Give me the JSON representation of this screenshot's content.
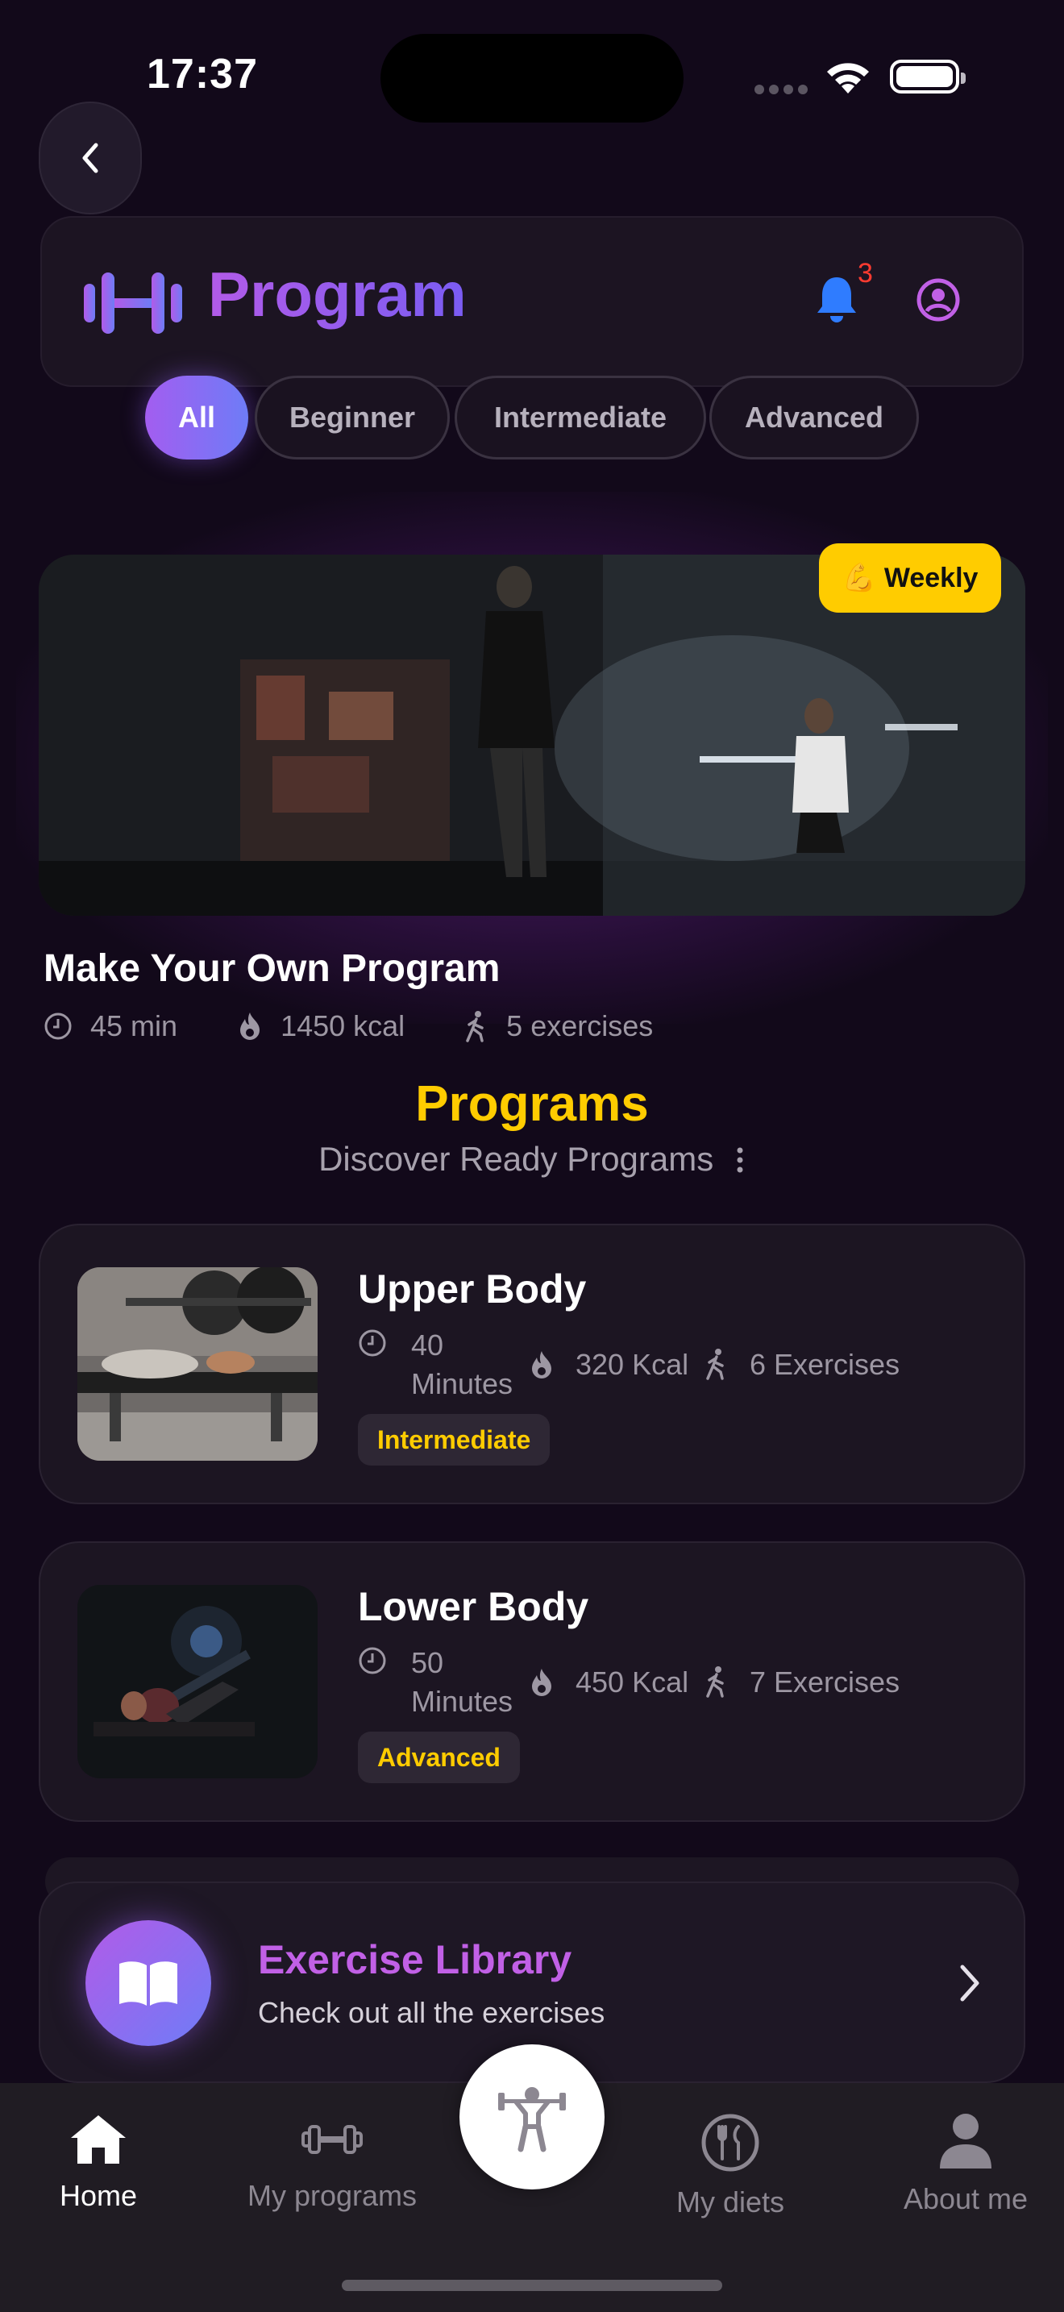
{
  "status_bar": {
    "time": "17:37"
  },
  "header": {
    "title": "Program",
    "notification_count": "3"
  },
  "filters": [
    "All",
    "Beginner",
    "Intermediate",
    "Advanced"
  ],
  "featured": {
    "badge_emoji": "💪",
    "badge_label": "Weekly",
    "title": "Make Your Own Program",
    "duration": "45 min",
    "calories": "1450 kcal",
    "exercises": "5 exercises"
  },
  "programs_section": {
    "title": "Programs",
    "subtitle": "Discover Ready Programs"
  },
  "programs": [
    {
      "title": "Upper Body",
      "duration_value": "40",
      "duration_unit": "Minutes",
      "calories": "320 Kcal",
      "exercises": "6 Exercises",
      "level": "Intermediate"
    },
    {
      "title": "Lower Body",
      "duration_value": "50",
      "duration_unit": "Minutes",
      "calories": "450 Kcal",
      "exercises": "7 Exercises",
      "level": "Advanced"
    }
  ],
  "exercise_library": {
    "title": "Exercise Library",
    "subtitle": "Check out all the exercises"
  },
  "tabbar": [
    {
      "label": "Home",
      "icon": "home-icon"
    },
    {
      "label": "My programs",
      "icon": "dumbbell-icon"
    },
    {
      "label": "My diets",
      "icon": "utensils-icon"
    },
    {
      "label": "About me",
      "icon": "person-icon"
    }
  ],
  "colors": {
    "accent_purple": "#b25be8",
    "accent_blue": "#6e7cf7",
    "accent_yellow": "#ffcc00",
    "background": "#12091a"
  }
}
